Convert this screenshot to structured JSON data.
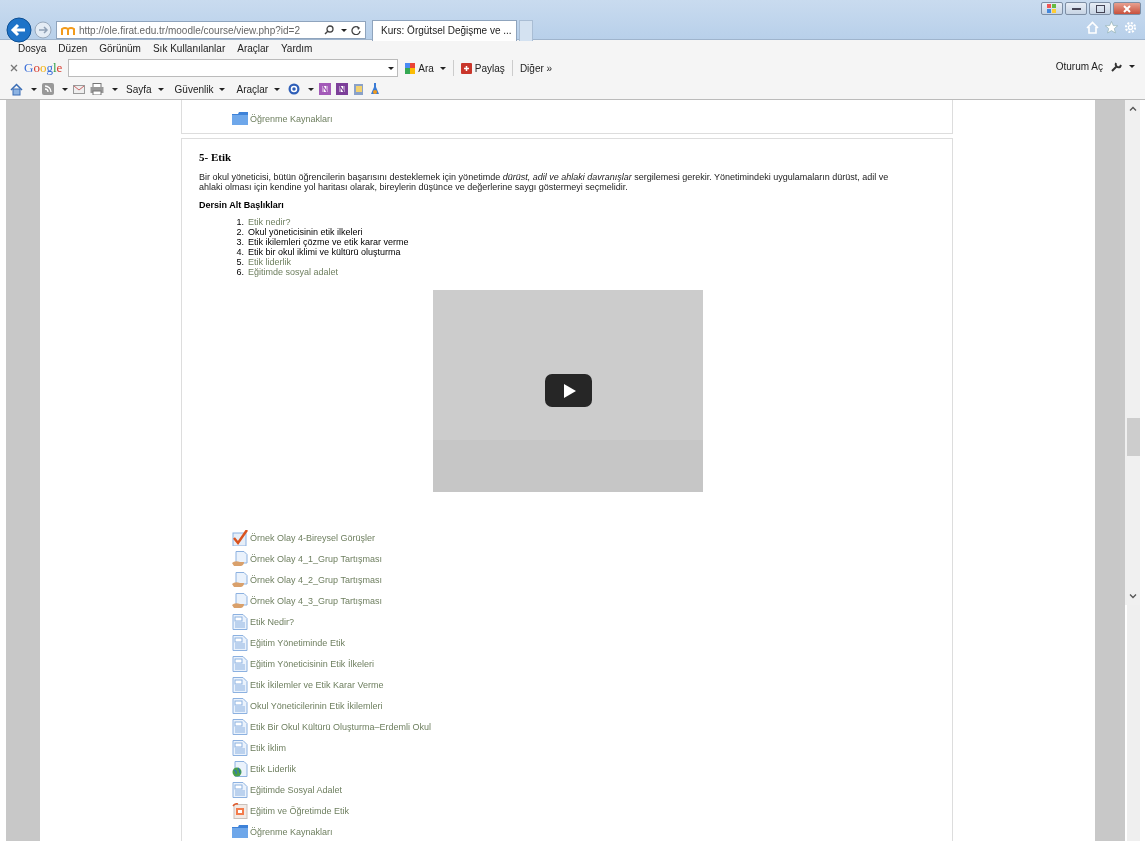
{
  "browser": {
    "address": "http://ole.firat.edu.tr/moodle/course/view.php?id=2",
    "tab_title": "Kurs: Örgütsel Değişme ve ...",
    "menu": [
      "Dosya",
      "Düzen",
      "Görünüm",
      "Sık Kullanılanlar",
      "Araçlar",
      "Yardım"
    ],
    "google_bar": {
      "logo": "Google",
      "search_button": "Ara",
      "share_button": "Paylaş",
      "more_button": "Diğer »",
      "sign_in": "Oturum Aç"
    },
    "command_bar": [
      "Sayfa",
      "Güvenlik",
      "Araçlar"
    ]
  },
  "previous_section": {
    "activities": [
      {
        "kind": "folder",
        "title": "Öğrenme Kaynakları"
      }
    ]
  },
  "section": {
    "title": "5- Etik",
    "summary": "Bir okul yöneticisi, bütün öğrencilerin başarısını desteklemek için yönetimde *dürüst, adil ve ahlaki davranışlar* sergilemesi gerekir. Yönetimindeki uygulamaların dürüst, adil ve ahlaki olması için kendine yol haritası olarak, bireylerin düşünce ve değerlerine saygı göstermeyi seçmelidir.",
    "subheading": "Dersin Alt Başlıkları",
    "topics": [
      {
        "number": "1.",
        "text": "Etik nedir?",
        "link": true
      },
      {
        "number": "2.",
        "text": "Okul yöneticisinin etik ilkeleri",
        "link": false
      },
      {
        "number": "3.",
        "text": "Etik ikilemleri çözme ve etik karar verme",
        "link": false
      },
      {
        "number": "4.",
        "text": "Etik bir okul iklimi ve kültürü oluşturma",
        "link": false
      },
      {
        "number": "5.",
        "text": "Etik liderlik",
        "link": true
      },
      {
        "number": "6.",
        "text": "Eğitimde sosyal adalet",
        "link": true
      }
    ],
    "activities": [
      {
        "kind": "assignment",
        "title": "Örnek Olay 4-Bireysel Görüşler"
      },
      {
        "kind": "forum",
        "title": "Örnek Olay 4_1_Grup Tartışması"
      },
      {
        "kind": "forum",
        "title": "Örnek Olay 4_2_Grup Tartışması"
      },
      {
        "kind": "forum",
        "title": "Örnek Olay 4_3_Grup Tartışması"
      },
      {
        "kind": "page",
        "title": "Etik Nedir?"
      },
      {
        "kind": "page",
        "title": "Eğitim Yönetiminde Etik"
      },
      {
        "kind": "page",
        "title": "Eğitim Yöneticisinin Etik İlkeleri"
      },
      {
        "kind": "page",
        "title": "Etik İkilemler ve Etik Karar Verme"
      },
      {
        "kind": "page",
        "title": "Okul Yöneticilerinin Etik İkilemleri"
      },
      {
        "kind": "page",
        "title": "Etik Bir Okul Kültürü Oluşturma–Erdemli Okul"
      },
      {
        "kind": "page",
        "title": "Etik İklim"
      },
      {
        "kind": "url",
        "title": "Etik Liderlik"
      },
      {
        "kind": "page",
        "title": "Eğitimde Sosyal Adalet"
      },
      {
        "kind": "file",
        "title": "Eğitim ve Öğretimde Etik"
      },
      {
        "kind": "folder",
        "title": "Öğrenme Kaynakları"
      }
    ]
  }
}
